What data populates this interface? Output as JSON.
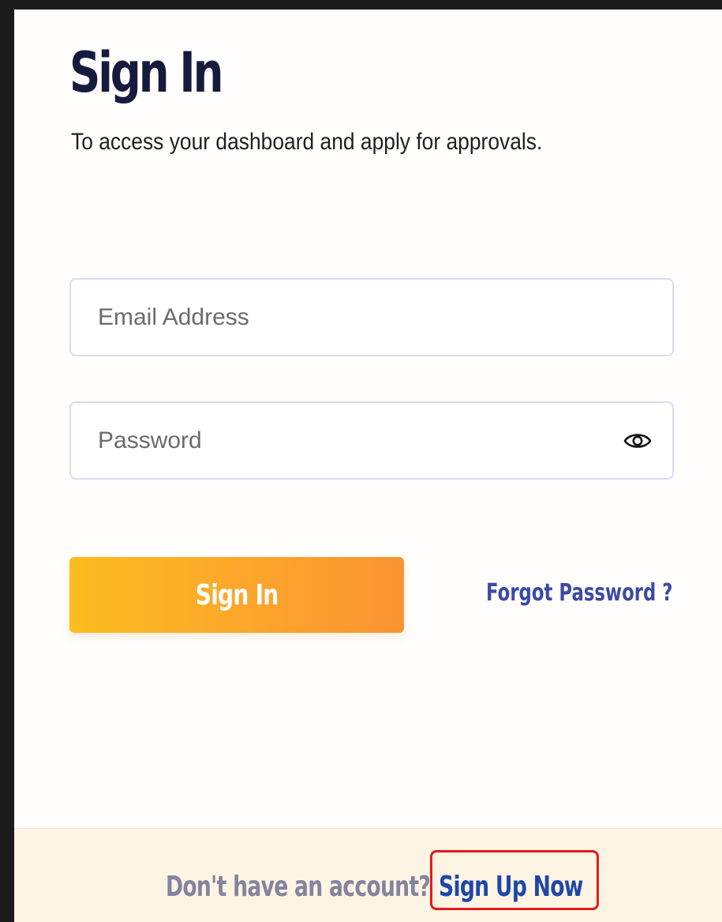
{
  "page": {
    "title": "Sign In",
    "subtitle": "To access your dashboard and apply for approvals."
  },
  "form": {
    "email": {
      "placeholder": "Email Address",
      "value": ""
    },
    "password": {
      "placeholder": "Password",
      "value": "",
      "toggle_icon": "eye-icon"
    },
    "submit_label": "Sign In",
    "forgot_label": "Forgot Password ?"
  },
  "footer": {
    "prompt": "Don't have an account?",
    "signup_label": "Sign Up Now"
  },
  "colors": {
    "title": "#161a3d",
    "button_gradient_start": "#fbbd1f",
    "button_gradient_end": "#fb9431",
    "link": "#3b4aa6",
    "footer_background": "#fdf4e4",
    "highlight": "#e01b1b"
  }
}
